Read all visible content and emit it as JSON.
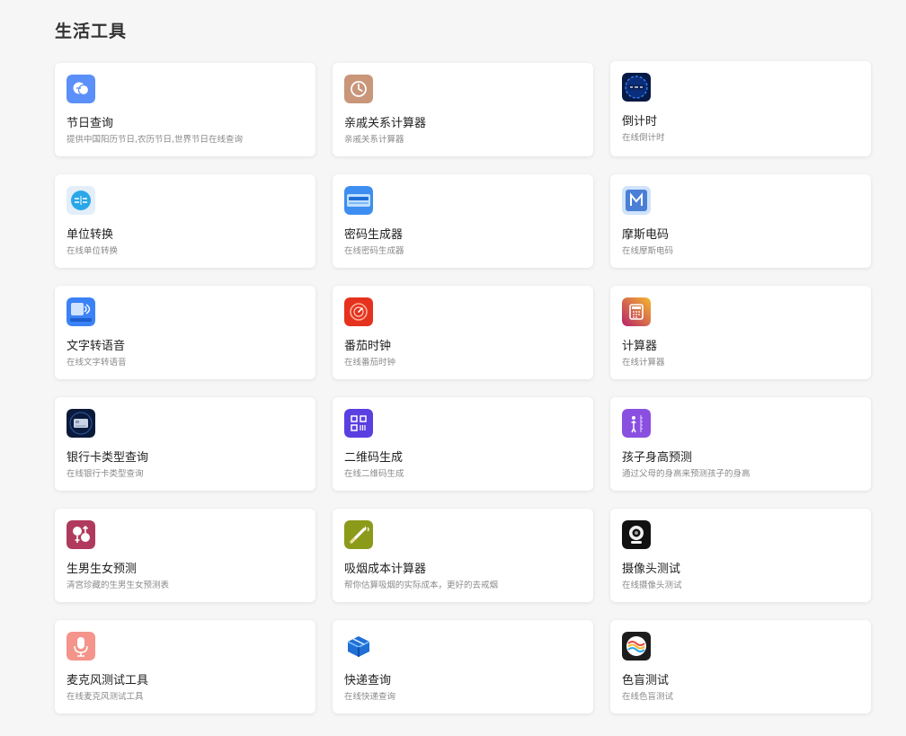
{
  "section": {
    "title": "生活工具"
  },
  "tools": [
    {
      "name": "节日查询",
      "desc": "提供中国阳历节日,农历节日,世界节日在线查询",
      "icon": "chat-bubble-icon",
      "color": "#5b8ff9"
    },
    {
      "name": "亲戚关系计算器",
      "desc": "亲戚关系计算器",
      "icon": "clock-icon",
      "color": "#c9967a"
    },
    {
      "name": "倒计时",
      "desc": "在线倒计时",
      "icon": "countdown-icon",
      "color": "#0a2a6b"
    },
    {
      "name": "单位转换",
      "desc": "在线单位转换",
      "icon": "unit-convert-icon",
      "color": "#2aa7e8"
    },
    {
      "name": "密码生成器",
      "desc": "在线密码生成器",
      "icon": "password-generator-icon",
      "color": "#3d8ef0"
    },
    {
      "name": "摩斯电码",
      "desc": "在线摩斯电码",
      "icon": "morse-code-icon",
      "color": "#4a7fd6"
    },
    {
      "name": "文字转语音",
      "desc": "在线文字转语音",
      "icon": "text-to-speech-icon",
      "color": "#3b82f6"
    },
    {
      "name": "番茄时钟",
      "desc": "在线番茄时钟",
      "icon": "tomato-clock-icon",
      "color": "#e5321f"
    },
    {
      "name": "计算器",
      "desc": "在线计算器",
      "icon": "calculator-icon",
      "color": "#d83b5e"
    },
    {
      "name": "银行卡类型查询",
      "desc": "在线银行卡类型查询",
      "icon": "bank-card-icon",
      "color": "#0b1a3a"
    },
    {
      "name": "二维码生成",
      "desc": "在线二维码生成",
      "icon": "qr-code-icon",
      "color": "#5b3fe0"
    },
    {
      "name": "孩子身高预测",
      "desc": "通过父母的身高来预测孩子的身高",
      "icon": "height-ruler-icon",
      "color": "#8a4fe0"
    },
    {
      "name": "生男生女预测",
      "desc": "清宫珍藏的生男生女预测表",
      "icon": "gender-icon",
      "color": "#b03a5e"
    },
    {
      "name": "吸烟成本计算器",
      "desc": "帮你估算吸烟的实际成本，更好的去戒烟",
      "icon": "smoking-icon",
      "color": "#8c9a1a"
    },
    {
      "name": "摄像头测试",
      "desc": "在线摄像头测试",
      "icon": "webcam-icon",
      "color": "#111111"
    },
    {
      "name": "麦克风测试工具",
      "desc": "在线麦克风测试工具",
      "icon": "microphone-icon",
      "color": "#f4948a"
    },
    {
      "name": "快递查询",
      "desc": "在线快递查询",
      "icon": "package-icon",
      "color": "#1f6fd6"
    },
    {
      "name": "色盲测试",
      "desc": "在线色盲测试",
      "icon": "color-blind-icon",
      "color": "#1c1c1c"
    }
  ]
}
